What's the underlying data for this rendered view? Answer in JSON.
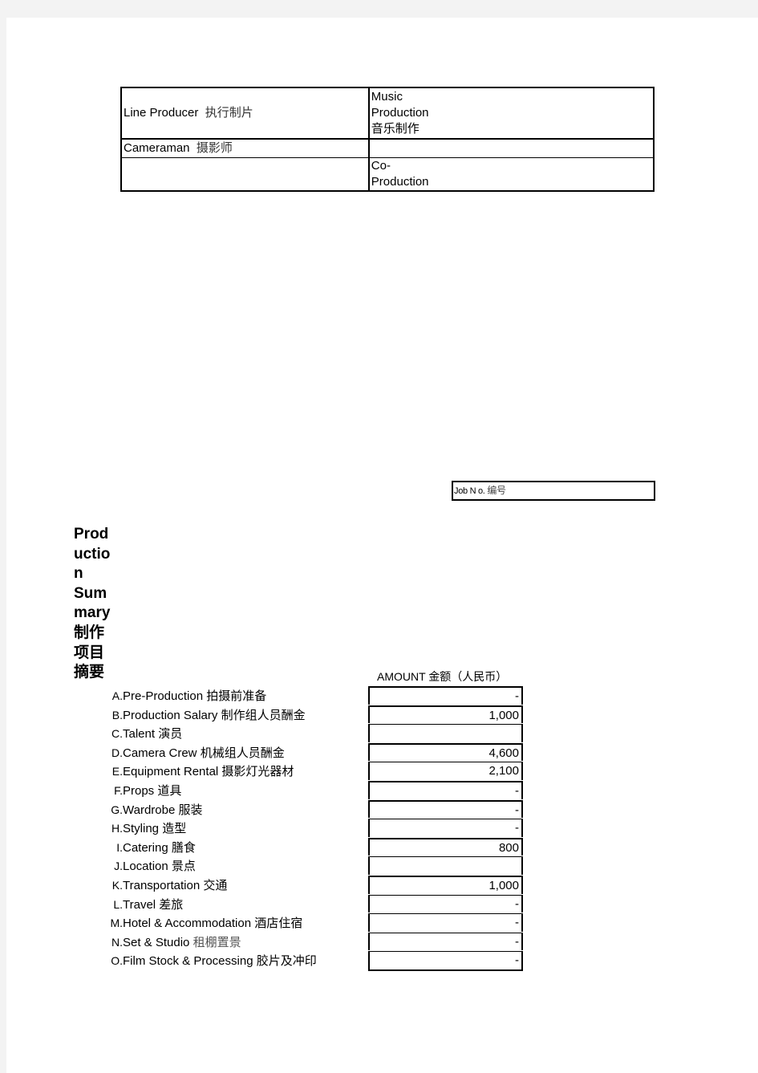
{
  "crew_table": {
    "rows": [
      {
        "role_en": "Line Producer",
        "role_zh": "执行制片",
        "right_lines": [
          "Music",
          "Production",
          "音乐制作"
        ]
      },
      {
        "role_en": "Cameraman",
        "role_zh": "摄影师",
        "right_lines": []
      },
      {
        "role_en": "",
        "role_zh": "",
        "right_lines": [
          "Co-",
          "Production"
        ]
      }
    ]
  },
  "job_no": {
    "label_en": "Job N o.",
    "label_zh": "编号",
    "value": ""
  },
  "summary": {
    "title_lines": [
      "Prod",
      "uctio",
      "n",
      "Sum",
      "mary",
      "制作",
      "项目",
      "摘要"
    ],
    "amount_header": "AMOUNT 金额（人民币）",
    "items": [
      {
        "letter": "A.",
        "en": "Pre-Production",
        "zh": "拍摄前准备",
        "amount": "-"
      },
      {
        "letter": "B.",
        "en": "Production Salary",
        "zh": "制作组人员酬金",
        "amount": "1,000"
      },
      {
        "letter": "C.",
        "en": "Talent",
        "zh": "演员",
        "amount": ""
      },
      {
        "letter": "D.",
        "en": "Camera Crew",
        "zh": "机械组人员酬金",
        "amount": "4,600"
      },
      {
        "letter": "E.",
        "en": "Equipment Rental",
        "zh": "摄影灯光器材",
        "amount": "2,100"
      },
      {
        "letter": "F.",
        "en": "Props",
        "zh": "道具",
        "amount": "-"
      },
      {
        "letter": "G.",
        "en": "Wardrobe",
        "zh": "服装",
        "amount": "-"
      },
      {
        "letter": "H.",
        "en": "Styling",
        "zh": "造型",
        "amount": "-"
      },
      {
        "letter": "I.",
        "en": "Catering",
        "zh": "膳食",
        "amount": "800"
      },
      {
        "letter": "J.",
        "en": "Location",
        "zh": "景点",
        "amount": ""
      },
      {
        "letter": "K.",
        "en": "Transportation",
        "zh": "交通",
        "amount": "1,000"
      },
      {
        "letter": "L.",
        "en": "Travel",
        "zh": "差旅",
        "amount": "-"
      },
      {
        "letter": "M.",
        "en": "Hotel & Accommodation",
        "zh": "酒店住宿",
        "amount": "-"
      },
      {
        "letter": "N.",
        "en": "Set & Studio",
        "zh": "租棚置景",
        "amount": "-"
      },
      {
        "letter": "O.",
        "en": "Film Stock & Processing",
        "zh": "胶片及冲印",
        "amount": "-"
      }
    ]
  }
}
